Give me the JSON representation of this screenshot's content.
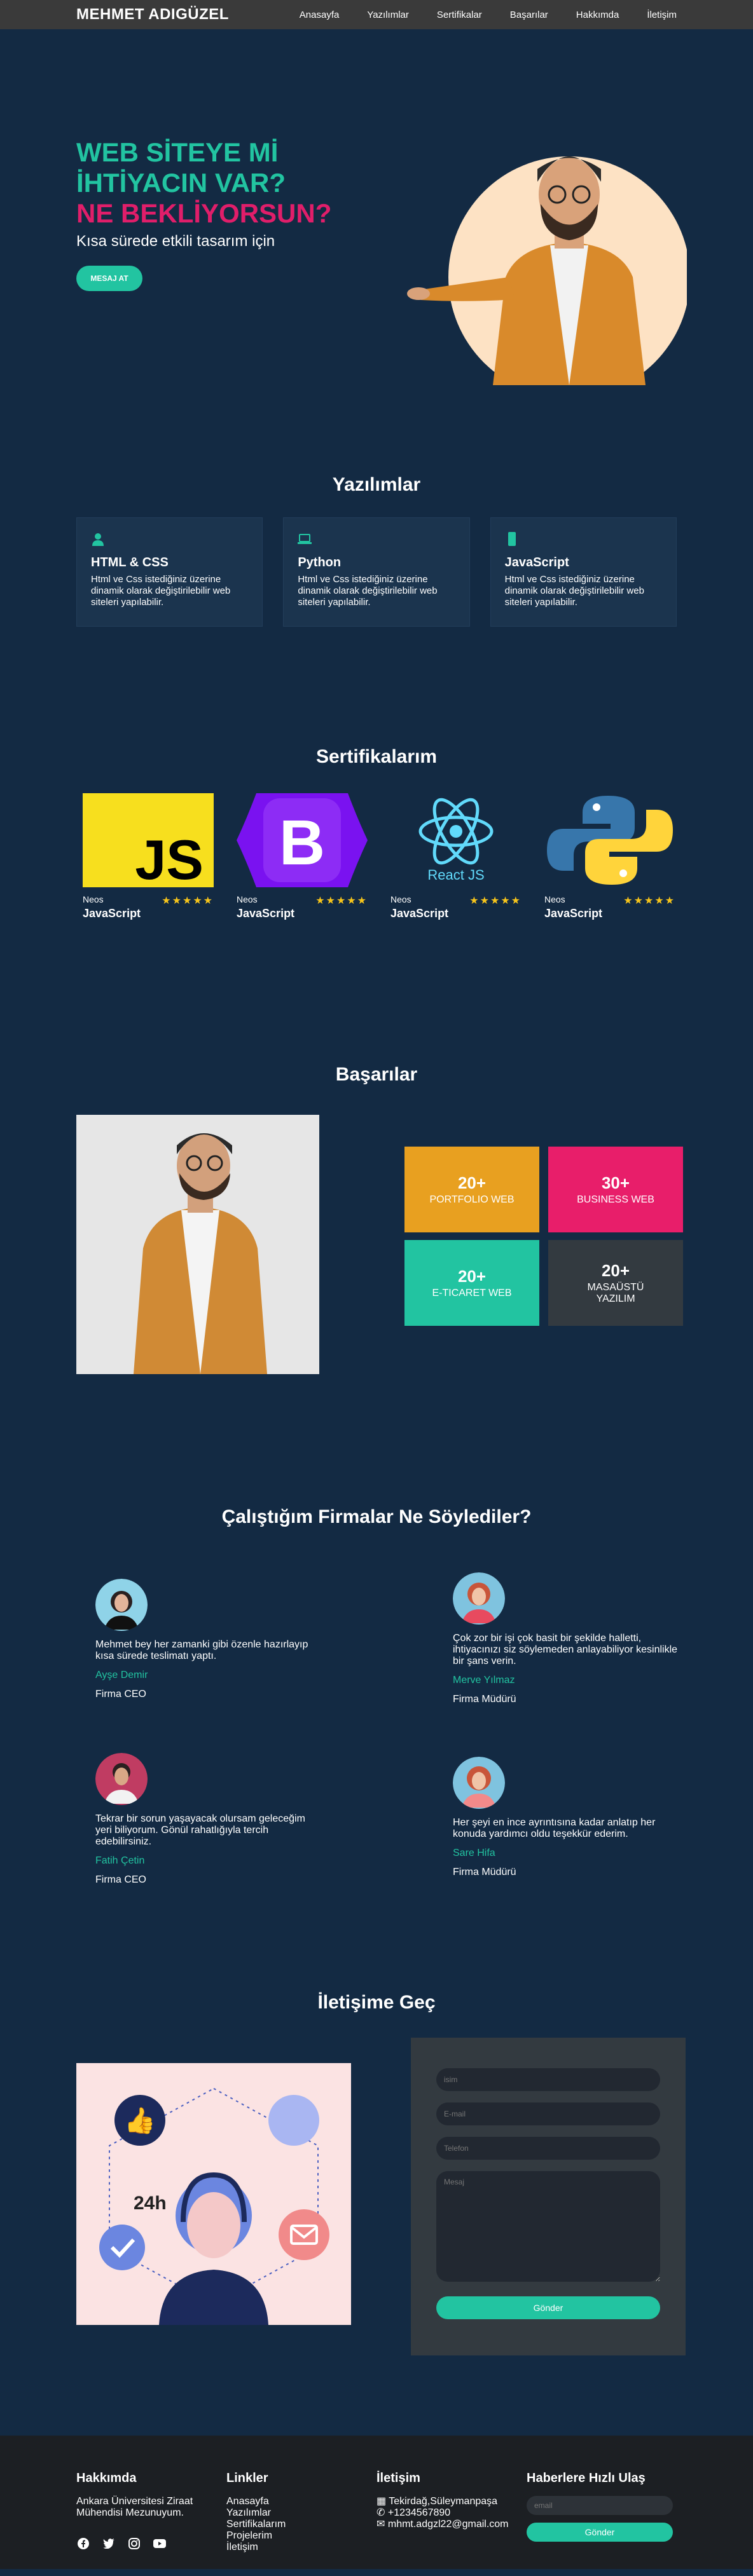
{
  "nav": {
    "brand": "MEHMET ADIGÜZEL",
    "links": [
      "Anasayfa",
      "Yazılımlar",
      "Sertifikalar",
      "Başarılar",
      "Hakkımda",
      "İletişim"
    ]
  },
  "hero": {
    "line1": "WEB SİTEYE Mİ",
    "line2": "İHTİYACIN VAR?",
    "line3": "NE BEKLİYORSUN?",
    "subtitle": "Kısa sürede etkili tasarım için",
    "button": "MESAJ AT"
  },
  "software": {
    "title": "Yazılımlar",
    "cards": [
      {
        "title": "HTML & CSS",
        "text": "Html ve Css istediğiniz üzerine dinamik olarak değiştirilebilir web siteleri yapılabilir.",
        "icon": "user-icon"
      },
      {
        "title": "Python",
        "text": "Html ve Css istediğiniz üzerine dinamik olarak değiştirilebilir web siteleri yapılabilir.",
        "icon": "laptop-icon"
      },
      {
        "title": "JavaScript",
        "text": "Html ve Css istediğiniz üzerine dinamik olarak değiştirilebilir web siteleri yapılabilir.",
        "icon": "mobile-icon"
      }
    ]
  },
  "certificates": {
    "title": "Sertifikalarım",
    "items": [
      {
        "issuer": "Neos",
        "name": "JavaScript",
        "logo": "JS",
        "stars": "★★★★★"
      },
      {
        "issuer": "Neos",
        "name": "JavaScript",
        "logo": "B",
        "stars": "★★★★★"
      },
      {
        "issuer": "Neos",
        "name": "JavaScript",
        "logo": "React JS",
        "stars": "★★★★★"
      },
      {
        "issuer": "Neos",
        "name": "JavaScript",
        "logo": "python",
        "stars": "★★★★★"
      }
    ]
  },
  "achievements": {
    "title": "Başarılar",
    "items": [
      {
        "num": "20+",
        "label": "PORTFOLIO WEB",
        "color": "#e8a020"
      },
      {
        "num": "30+",
        "label": "BUSINESS WEB",
        "color": "#e81e6a"
      },
      {
        "num": "20+",
        "label": "E-TICARET WEB",
        "color": "#22c4a1"
      },
      {
        "num": "20+",
        "label": "MASAÜSTÜ YAZILIM",
        "color": "#333a40"
      }
    ]
  },
  "testimonials": {
    "title": "Çalıştığım Firmalar Ne Söylediler?",
    "items": [
      {
        "text": "Mehmet bey her zamanki gibi özenle hazırlayıp kısa sürede teslimatı yaptı.",
        "name": "Ayşe Demir",
        "role": "Firma CEO"
      },
      {
        "text": "Çok zor bir işi çok basit bir şekilde halletti, ihtiyacınızı siz söylemeden anlayabiliyor kesinlikle bir şans verin.",
        "name": "Merve Yılmaz",
        "role": "Firma Müdürü"
      },
      {
        "text": "Tekrar bir sorun yaşayacak olursam geleceğim yeri biliyorum. Gönül rahatlığıyla tercih edebilirsiniz.",
        "name": "Fatih Çetin",
        "role": "Firma CEO"
      },
      {
        "text": "Her şeyi en ince ayrıntısına kadar anlatıp her konuda yardımcı oldu teşekkür ederim.",
        "name": "Sare Hifa",
        "role": "Firma Müdürü"
      }
    ]
  },
  "contact": {
    "title": "İletişime Geç",
    "badge": "24h",
    "placeholders": {
      "name": "isim",
      "email": "E-mail",
      "phone": "Telefon",
      "message": "Mesaj"
    },
    "button": "Gönder"
  },
  "footer": {
    "about_title": "Hakkımda",
    "about_text": "Ankara Üniversitesi Ziraat Mühendisi Mezunuyum.",
    "links_title": "Linkler",
    "links": [
      "Anasayfa",
      "Yazılımlar",
      "Sertifikalarım",
      "Projelerim",
      "İletişim"
    ],
    "contact_title": "İletişim",
    "address": "Tekirdağ,Süleymanpaşa",
    "phone": "+1234567890",
    "email": "mhmt.adgzl22@gmail.com",
    "news_title": "Haberlere Hızlı Ulaş",
    "news_placeholder": "email",
    "news_button": "Gönder"
  }
}
